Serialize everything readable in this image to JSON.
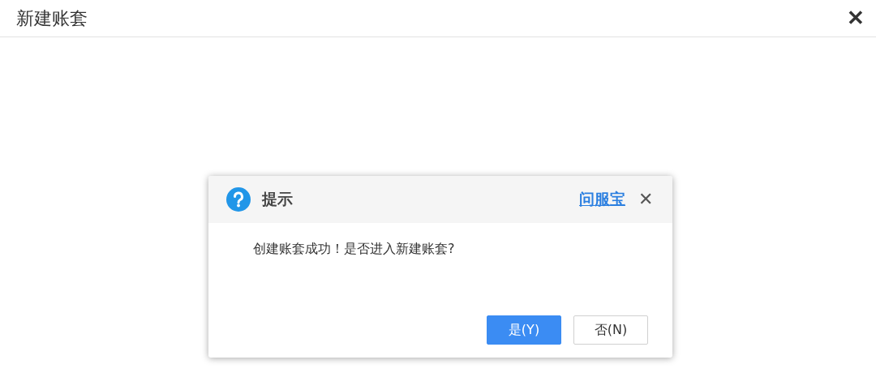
{
  "window": {
    "title": "新建账套",
    "close": "✕"
  },
  "dialog": {
    "title": "提示",
    "help_link": "问服宝",
    "close": "✕",
    "message": "创建账套成功！是否进入新建账套?",
    "buttons": [
      {
        "label": "是(Y)",
        "kind": "primary"
      },
      {
        "label": "否(N)",
        "kind": "default"
      }
    ]
  }
}
